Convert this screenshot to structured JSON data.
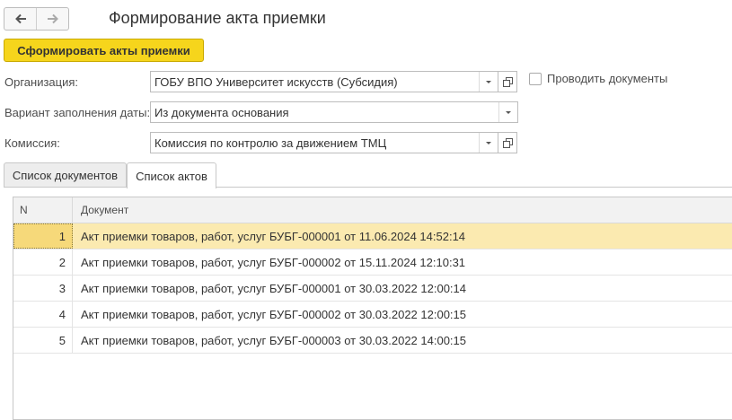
{
  "window": {
    "title": "Формирование акта приемки"
  },
  "toolbar": {
    "create_acts_label": "Сформировать акты приемки"
  },
  "form": {
    "organization": {
      "label": "Организация:",
      "value": "ГОБУ ВПО Университет искусств (Субсидия)"
    },
    "date_fill": {
      "label": "Вариант заполнения даты:",
      "value": "Из документа основания"
    },
    "commission": {
      "label": "Комиссия:",
      "value": "Комиссия по контролю за движением ТМЦ"
    },
    "post_documents": {
      "label": "Проводить документы",
      "checked": false
    }
  },
  "tabs": [
    {
      "label": "Список документов",
      "active": false
    },
    {
      "label": "Список актов",
      "active": true
    }
  ],
  "table": {
    "columns": [
      "N",
      "Документ"
    ],
    "rows": [
      {
        "n": "1",
        "document": "Акт приемки товаров, работ, услуг БУБГ-000001 от 11.06.2024 14:52:14",
        "selected": true
      },
      {
        "n": "2",
        "document": "Акт приемки товаров, работ, услуг БУБГ-000002 от 15.11.2024 12:10:31",
        "selected": false
      },
      {
        "n": "3",
        "document": "Акт приемки товаров, работ, услуг БУБГ-000001 от 30.03.2022 12:00:14",
        "selected": false
      },
      {
        "n": "4",
        "document": "Акт приемки товаров, работ, услуг БУБГ-000002 от 30.03.2022 12:00:15",
        "selected": false
      },
      {
        "n": "5",
        "document": "Акт приемки товаров, работ, услуг БУБГ-000003 от 30.03.2022 14:00:15",
        "selected": false
      }
    ]
  },
  "colors": {
    "accent": "#f6d51c",
    "selected_row": "#fbeab0"
  },
  "icons": [
    "back-arrow-icon",
    "forward-arrow-icon",
    "dropdown-icon",
    "open-icon",
    "checkbox-icon"
  ]
}
